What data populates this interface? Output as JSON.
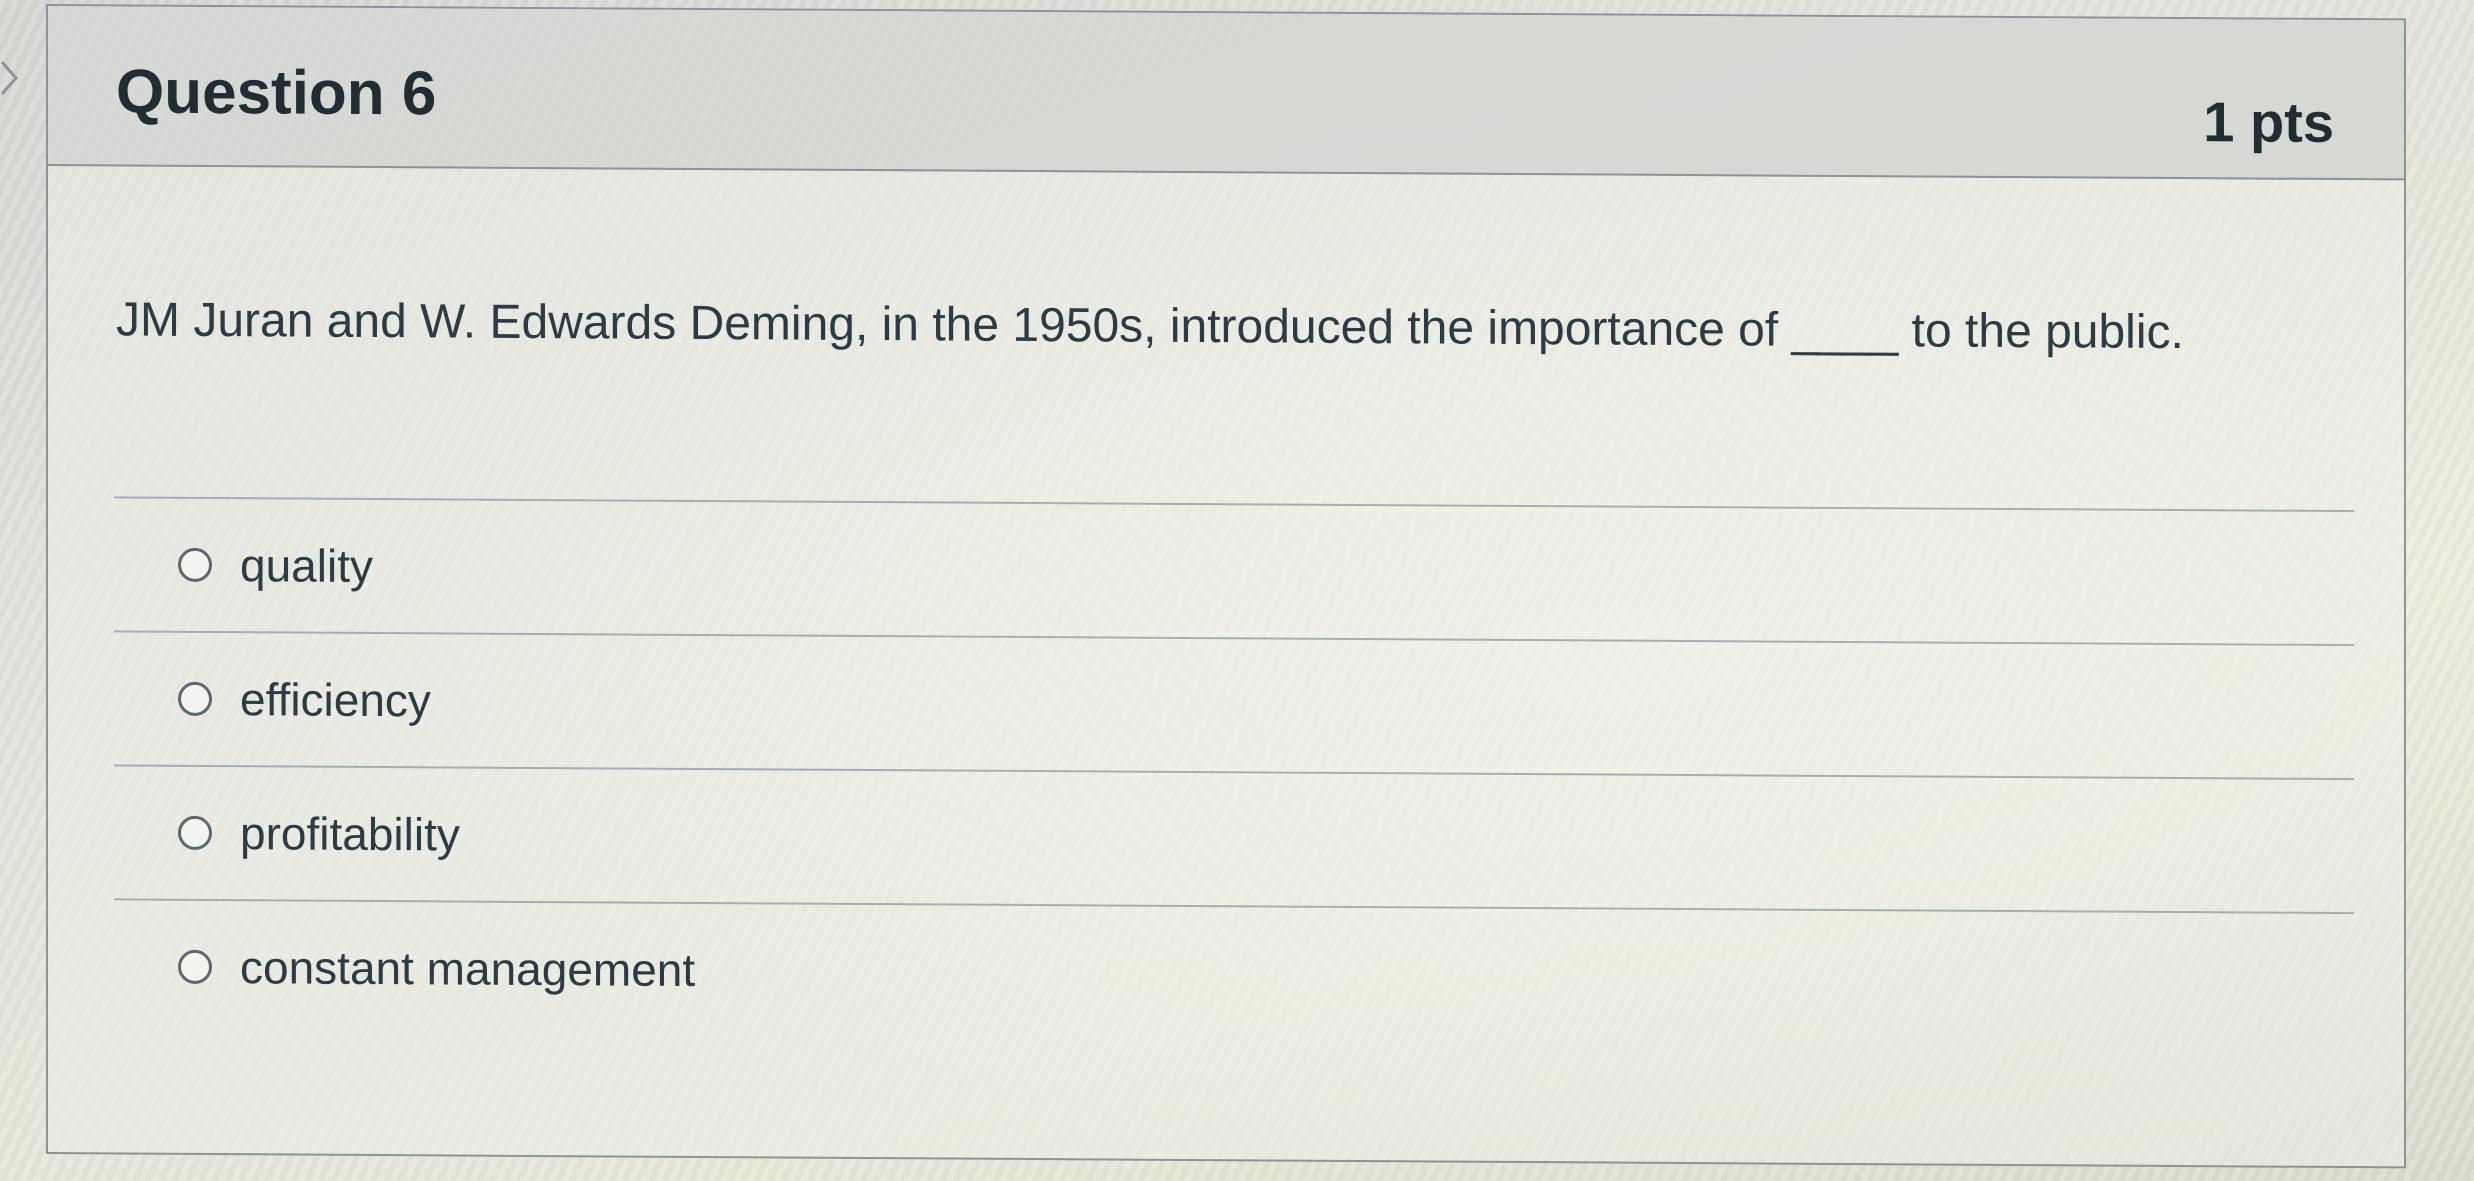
{
  "question": {
    "title": "Question 6",
    "points": "1 pts",
    "text": "JM Juran and W. Edwards Deming, in the 1950s, introduced the importance of ____ to the public."
  },
  "answers": [
    {
      "label": "quality",
      "selected": false
    },
    {
      "label": "efficiency",
      "selected": false
    },
    {
      "label": "profitability",
      "selected": false
    },
    {
      "label": "constant management",
      "selected": false
    }
  ],
  "icons": {
    "collapse": "chevron-right-icon",
    "option": "radio-empty-icon"
  },
  "colors": {
    "text": "#2d3b45",
    "border": "#8d9396",
    "header_bg": "#d2d5d1"
  }
}
